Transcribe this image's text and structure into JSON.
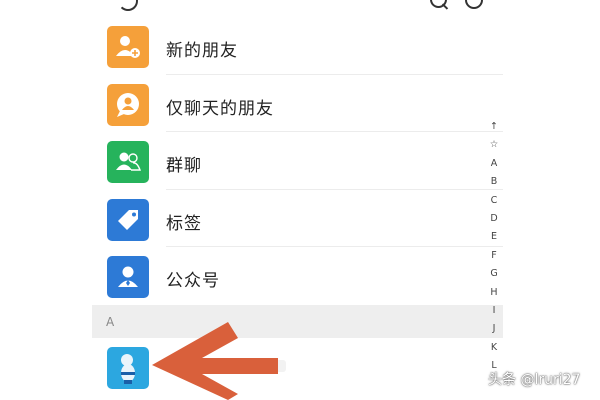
{
  "menu": {
    "items": [
      {
        "label": "新的朋友",
        "icon": "add-friend-icon",
        "color": "#f5a03a"
      },
      {
        "label": "仅聊天的朋友",
        "icon": "chat-only-friend-icon",
        "color": "#f5a03a"
      },
      {
        "label": "群聊",
        "icon": "group-chat-icon",
        "color": "#26b35c"
      },
      {
        "label": "标签",
        "icon": "tag-icon",
        "color": "#2d7ad6"
      },
      {
        "label": "公众号",
        "icon": "official-account-icon",
        "color": "#2d7ad6"
      }
    ]
  },
  "section": {
    "letter": "A"
  },
  "contact": {
    "avatar_icon": "cartoon-avatar-icon",
    "avatar_color": "#2ca7e0"
  },
  "index_bar": [
    "↑",
    "☆",
    "A",
    "B",
    "C",
    "D",
    "E",
    "F",
    "G",
    "H",
    "I",
    "J",
    "K",
    "L"
  ],
  "annotation": {
    "arrow_color": "#d9603b",
    "icon": "left-arrow-icon"
  },
  "watermark": "头条 @lruri27"
}
